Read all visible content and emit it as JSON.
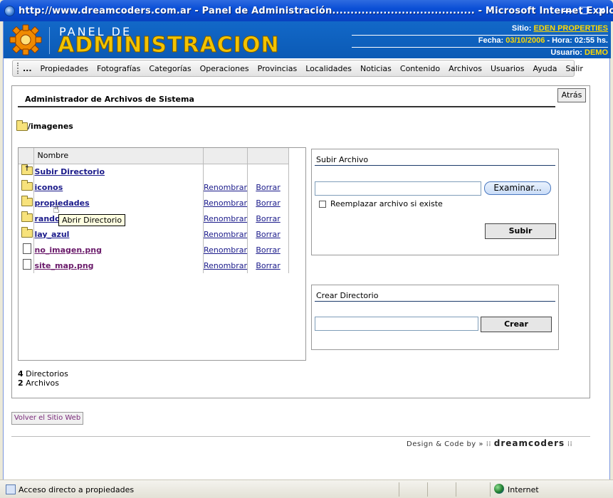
{
  "window": {
    "title": "http://www.dreamcoders.com.ar - Panel de Administración....................................... - Microsoft Internet Explorer",
    "minimize_glyph": "—",
    "maximize_glyph": "☐",
    "close_glyph": "✕"
  },
  "header": {
    "logo_small": "PANEL DE",
    "logo_big": "ADMINISTRACION",
    "sitio_label": "Sitio:",
    "sitio_value": "EDEN PROPERTIES",
    "fecha_label": "Fecha:",
    "fecha_value": "03/10/2006",
    "hora_label": "- Hora:",
    "hora_value": "02:55 hs.",
    "usuario_label": "Usuario:",
    "usuario_value": "DEMO"
  },
  "menu": {
    "more": "...",
    "items": [
      "Propiedades",
      "Fotografías",
      "Categorías",
      "Operaciones",
      "Provincias",
      "Localidades",
      "Noticias",
      "Contenido",
      "Archivos",
      "Usuarios",
      "Ayuda",
      "Salir"
    ]
  },
  "panel": {
    "title": "Administrador de Archivos de Sistema",
    "back_button": "Atrás",
    "path": "/imagenes"
  },
  "file_list": {
    "header_name": "Nombre",
    "up_label": "Subir Directorio",
    "rename_label": "Renombrar",
    "delete_label": "Borrar",
    "rows": [
      {
        "type": "folder",
        "name": "iconos"
      },
      {
        "type": "folder",
        "name": "propiedades"
      },
      {
        "type": "folder",
        "name": "random"
      },
      {
        "type": "folder",
        "name": "lay_azul"
      },
      {
        "type": "file",
        "name": "no_imagen.png"
      },
      {
        "type": "file",
        "name": "site_map.png"
      }
    ],
    "tooltip": "Abrir Directorio",
    "dir_count": "4",
    "dir_label": "Directorios",
    "file_count": "2",
    "file_label": "Archivos"
  },
  "upload": {
    "title": "Subir Archivo",
    "browse_button": "Examinar...",
    "replace_label": "Reemplazar archivo si existe",
    "submit_button": "Subir"
  },
  "mkdir": {
    "title": "Crear Directorio",
    "create_button": "Crear"
  },
  "footer": {
    "back_site_button": "Volver el Sitio Web",
    "credit_prefix": "Design & Code by »",
    "credit_brand": "dreamcoders"
  },
  "statusbar": {
    "text": "Acceso directo a propiedades",
    "zone": "Internet"
  },
  "colors": {
    "banner_blue": "#0B5AB5",
    "logo_yellow": "#F3C300",
    "info_yellow": "#FFD800",
    "link_blue": "#1A1A8A"
  }
}
